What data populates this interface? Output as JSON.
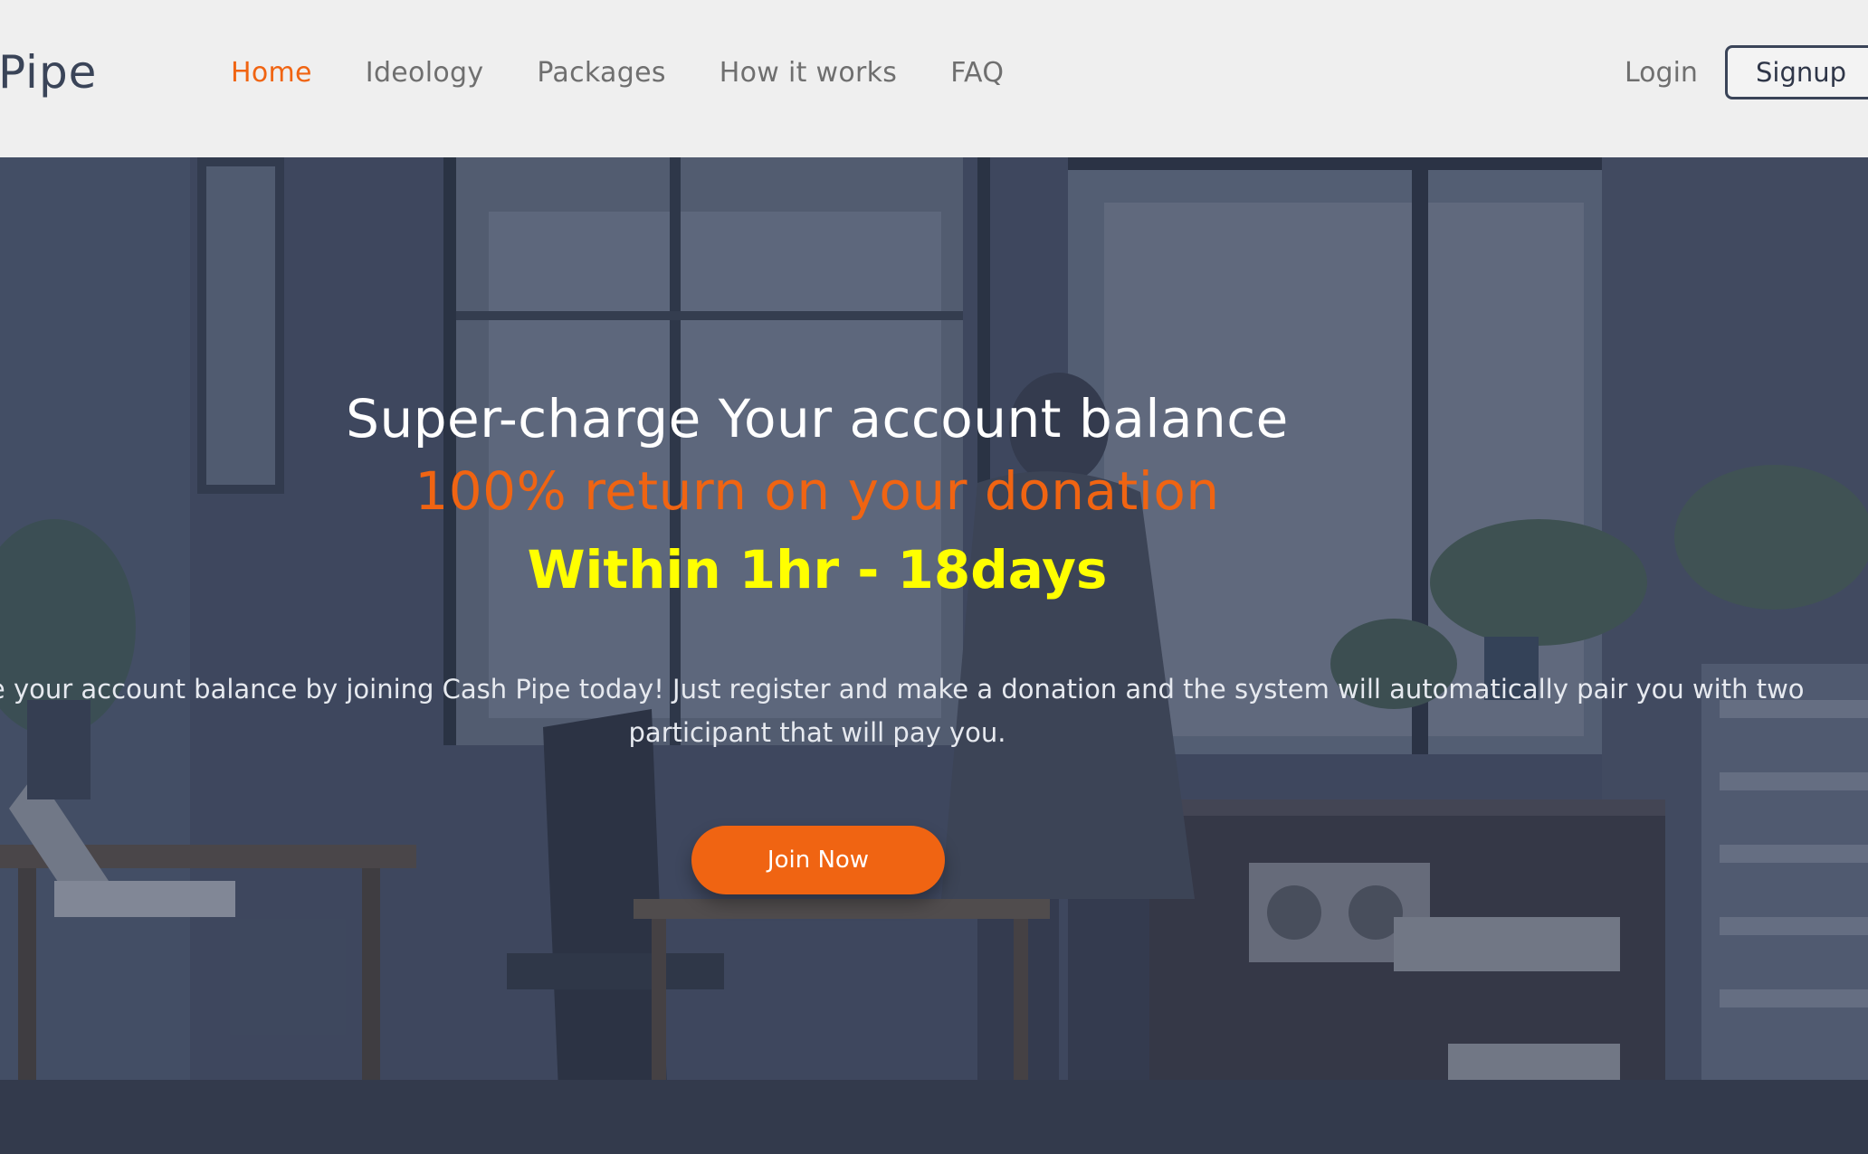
{
  "navbar": {
    "brand": "Pipe",
    "links": [
      {
        "label": "Home",
        "active": true
      },
      {
        "label": "Ideology",
        "active": false
      },
      {
        "label": "Packages",
        "active": false
      },
      {
        "label": "How it works",
        "active": false
      },
      {
        "label": "FAQ",
        "active": false
      }
    ],
    "login_label": "Login",
    "signup_label": "Signup"
  },
  "hero": {
    "headline_line1": "Super-charge Your account balance",
    "headline_line2": "100% return on your donation",
    "headline_line3": "Within 1hr - 18days",
    "subtext": "Super-charge your account balance by joining Cash Pipe today! Just register and make a donation and the system will automatically pair you with two participant that will pay you.",
    "cta_label": "Join Now"
  },
  "colors": {
    "accent": "#f06412",
    "highlight": "#ffff00",
    "nav_background": "#efefef",
    "brand_text": "#3a4458"
  }
}
